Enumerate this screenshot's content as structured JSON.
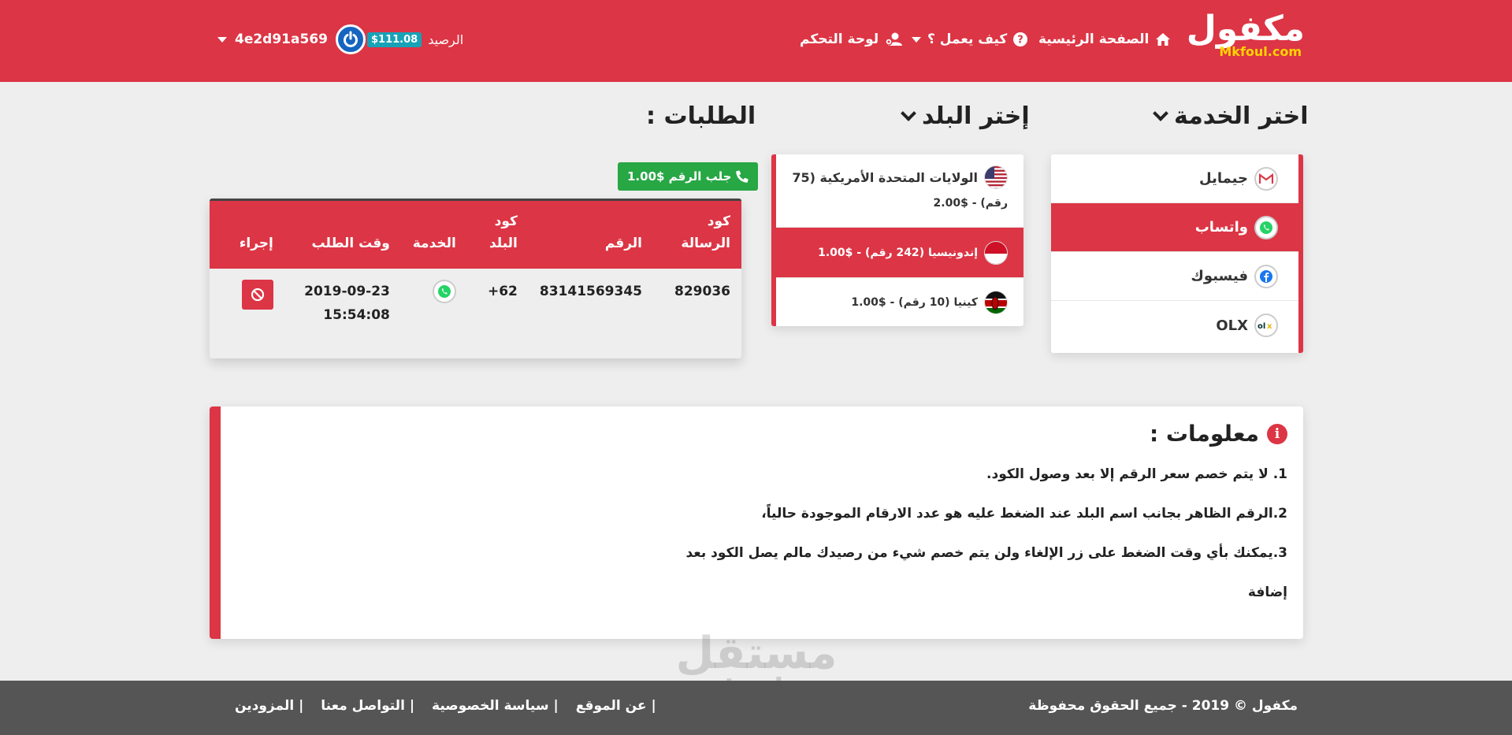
{
  "header": {
    "logo_ar": "مكفول",
    "logo_en": "Mkfoul.com",
    "nav_home": "الصفحة الرئيسية",
    "nav_how": "كيف يعمل ؟",
    "nav_dashboard": "لوحة التحكم",
    "balance_label": "الرصيد",
    "balance_value": "$111.08",
    "username": "4e2d91a569"
  },
  "services": {
    "title": "اختر الخدمة",
    "items": [
      {
        "label": "جيمايل",
        "icon": "gmail-icon"
      },
      {
        "label": "واتساب",
        "icon": "whatsapp-icon",
        "active": true
      },
      {
        "label": "فيسبوك",
        "icon": "facebook-icon"
      },
      {
        "label": "OLX",
        "icon": "olx-icon"
      }
    ]
  },
  "countries": {
    "title": "إختر البلد",
    "items": [
      {
        "name": "الولايات المتحدة الأمريكية (75",
        "price": "رقم) - $2.00",
        "flag": "usa-flag-icon"
      },
      {
        "name": "إندونيسيا (242 رقم) - $1.00",
        "price": "",
        "flag": "indonesia-flag-icon",
        "active": true
      },
      {
        "name": "كينيا (10 رقم) - $1.00",
        "price": "",
        "flag": "kenya-flag-icon"
      }
    ]
  },
  "orders": {
    "title": "الطلبات :",
    "get_number_button": "جلب الرقم $1.00",
    "columns": [
      "كود الرسالة",
      "الرقم",
      "كود البلد",
      "الخدمة",
      "وقت الطلب",
      "إجراء"
    ],
    "rows": [
      {
        "code": "829036",
        "number": "83141569345",
        "country_code": "62+",
        "service": "whatsapp-icon",
        "date": "2019-09-23",
        "time": "15:54:08",
        "action": "cancel-icon"
      }
    ]
  },
  "info": {
    "title": "معلومات :",
    "lines": [
      "1. لا يتم خصم سعر الرقم إلا بعد وصول الكود.",
      "2.الرقم الظاهر بجانب اسم البلد عند الضغط عليه هو عدد الارقام الموجودة حالياً،",
      "3.يمكنك بأي وقت الضغط على زر الإلغاء ولن يتم خصم شيء من رصيدك مالم يصل الكود بعد",
      "إضافة"
    ]
  },
  "watermark": {
    "ar": "مستقل",
    "en": "mostaql.com"
  },
  "footer": {
    "copyright": "مكفول © 2019 - جميع الحقوق محفوظة",
    "links": [
      "| عن الموقع",
      "| سياسة الخصوصية",
      "| التواصل معنا",
      "| المزودين"
    ]
  },
  "colors": {
    "brand": "#dc3545",
    "success": "#28a745",
    "badge": "#17a2b8",
    "footer": "#555555"
  }
}
